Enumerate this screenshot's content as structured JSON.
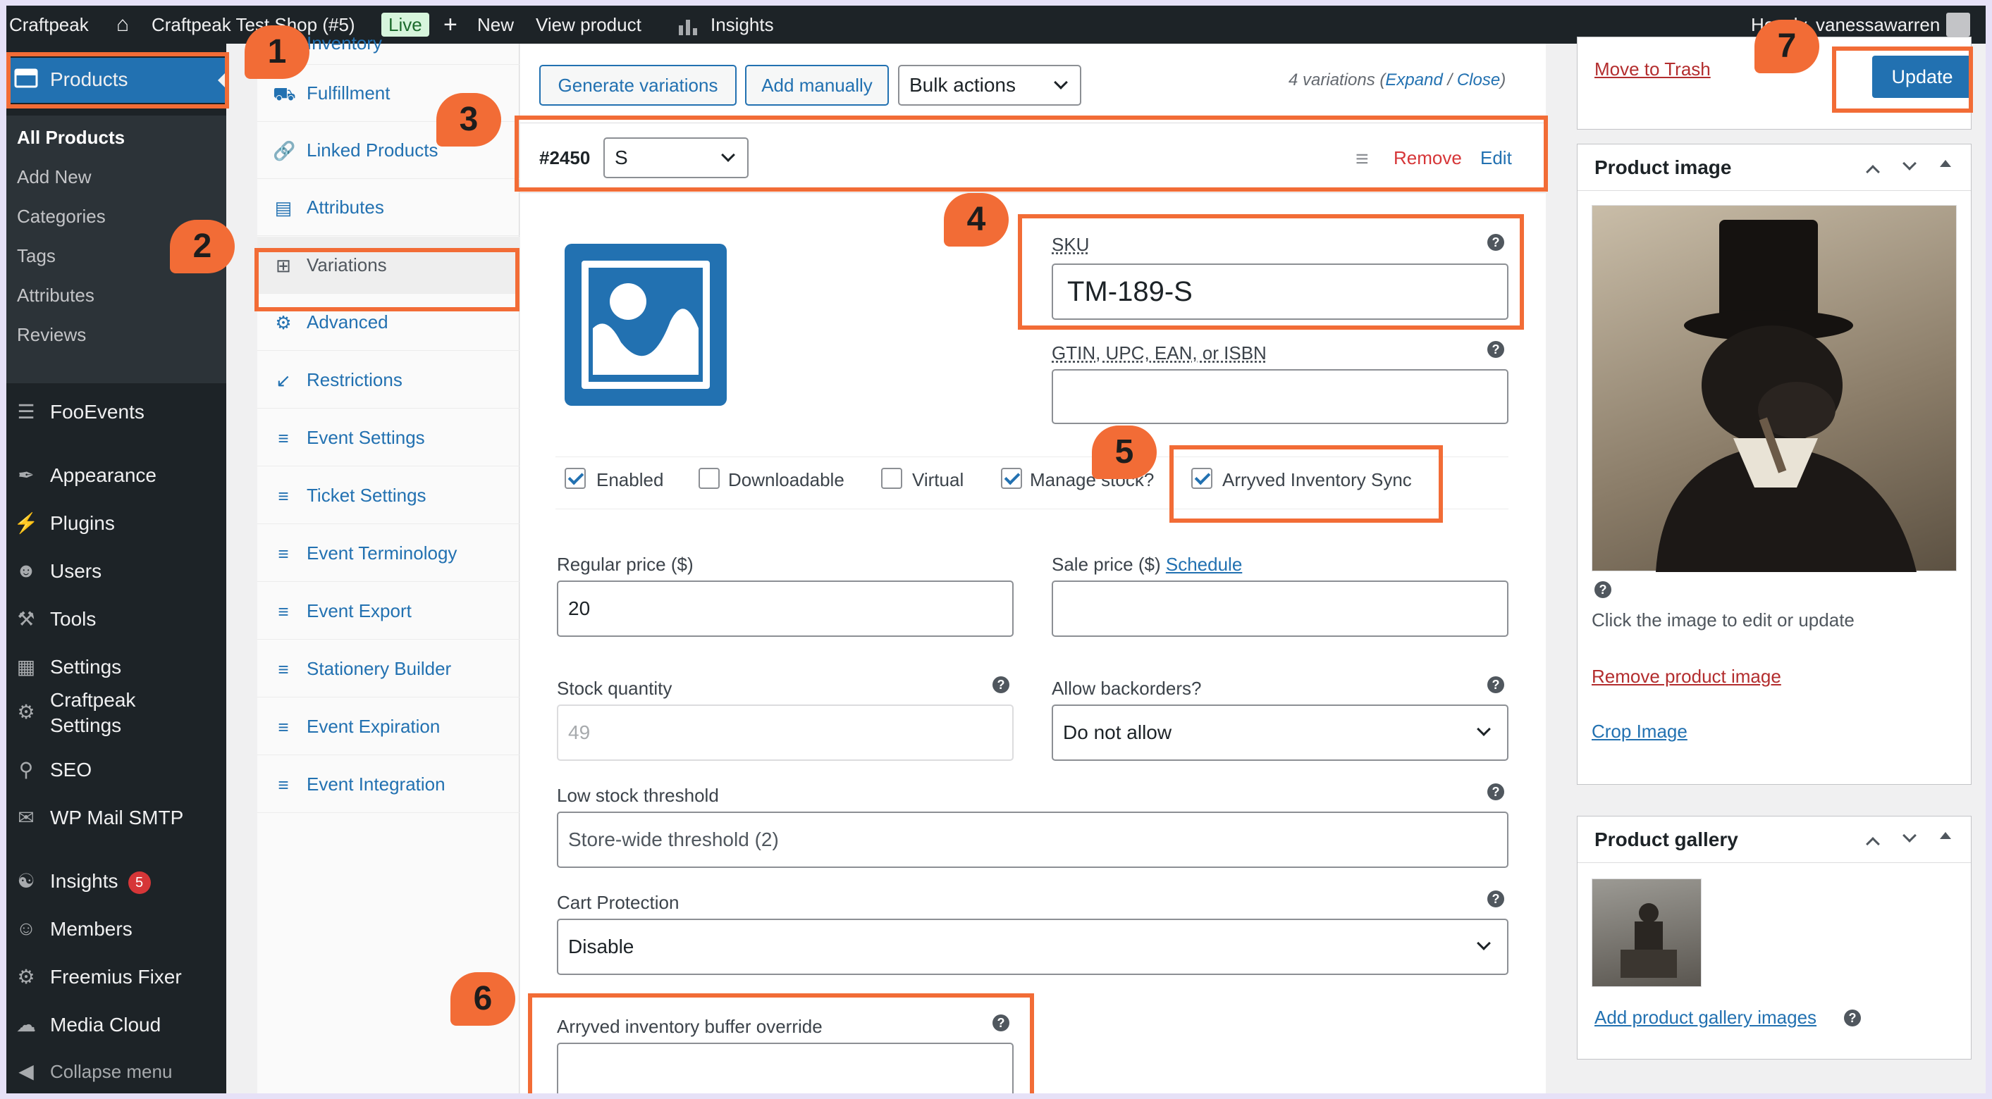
{
  "admin_bar": {
    "site_name": "Craftpeak",
    "shop_name": "Craftpeak Test Shop (#5)",
    "live_badge": "Live",
    "new_label": "New",
    "view_product": "View product",
    "insights": "Insights",
    "greeting": "Howdy, vanessawarren"
  },
  "sidebar": {
    "active_item": "Products",
    "submenu": [
      "All Products",
      "Add New",
      "Categories",
      "Tags",
      "Attributes",
      "Reviews"
    ],
    "items": [
      {
        "label": "FooEvents",
        "icon": "fooevents-icon"
      },
      {
        "label": "Appearance",
        "icon": "brush-icon"
      },
      {
        "label": "Plugins",
        "icon": "plugin-icon"
      },
      {
        "label": "Users",
        "icon": "user-icon"
      },
      {
        "label": "Tools",
        "icon": "wrench-icon"
      },
      {
        "label": "Settings",
        "icon": "settings-icon"
      },
      {
        "label": "Craftpeak Settings",
        "icon": "craftpeak-icon"
      },
      {
        "label": "SEO",
        "icon": "search-icon"
      },
      {
        "label": "WP Mail SMTP",
        "icon": "mail-icon"
      },
      {
        "label": "Insights",
        "icon": "insights-icon",
        "badge": "5"
      },
      {
        "label": "Members",
        "icon": "members-icon"
      },
      {
        "label": "Freemius Fixer",
        "icon": "gear-icon"
      },
      {
        "label": "Media Cloud",
        "icon": "cloud-icon"
      },
      {
        "label": "Collapse menu",
        "icon": "collapse-icon"
      }
    ]
  },
  "product_tabs": [
    {
      "label": "Inventory",
      "icon": "inventory-icon"
    },
    {
      "label": "Fulfillment",
      "icon": "truck-icon"
    },
    {
      "label": "Linked Products",
      "icon": "link-icon"
    },
    {
      "label": "Attributes",
      "icon": "list-icon"
    },
    {
      "label": "Variations",
      "icon": "grid-icon",
      "active": true
    },
    {
      "label": "Advanced",
      "icon": "gear-icon"
    },
    {
      "label": "Restrictions",
      "icon": "shrink-icon"
    },
    {
      "label": "Event Settings",
      "icon": "stack-icon"
    },
    {
      "label": "Ticket Settings",
      "icon": "stack-icon"
    },
    {
      "label": "Event Terminology",
      "icon": "stack-icon"
    },
    {
      "label": "Event Export",
      "icon": "stack-icon"
    },
    {
      "label": "Stationery Builder",
      "icon": "stack-icon"
    },
    {
      "label": "Event Expiration",
      "icon": "stack-icon"
    },
    {
      "label": "Event Integration",
      "icon": "stack-icon"
    }
  ],
  "toolbar": {
    "generate_variations": "Generate variations",
    "add_manually": "Add manually",
    "bulk_actions": "Bulk actions",
    "variations_count": "4 variations",
    "expand": "Expand",
    "slash": "/",
    "close": "Close"
  },
  "variation": {
    "id": "#2450",
    "attribute_value": "S",
    "remove": "Remove",
    "edit": "Edit",
    "sku_label": "SKU",
    "sku_value": "TM-189-S",
    "gtin_label": "GTIN, UPC, EAN, or ISBN",
    "gtin_value": "",
    "checkboxes": [
      {
        "label": "Enabled",
        "checked": true
      },
      {
        "label": "Downloadable",
        "checked": false
      },
      {
        "label": "Virtual",
        "checked": false
      },
      {
        "label": "Manage stock?",
        "checked": true
      },
      {
        "label": "Arryved Inventory Sync",
        "checked": true
      }
    ],
    "regular_price_label": "Regular price ($)",
    "regular_price_value": "20",
    "sale_price_label": "Sale price ($)",
    "schedule_link": "Schedule",
    "sale_price_value": "",
    "stock_qty_label": "Stock quantity",
    "stock_qty_placeholder": "49",
    "backorders_label": "Allow backorders?",
    "backorders_value": "Do not allow",
    "low_stock_label": "Low stock threshold",
    "low_stock_placeholder": "Store-wide threshold (2)",
    "cart_protection_label": "Cart Protection",
    "cart_protection_value": "Disable",
    "buffer_label": "Arryved inventory buffer override",
    "buffer_value": ""
  },
  "publish": {
    "move_to_trash": "Move to Trash",
    "update": "Update"
  },
  "product_image": {
    "title": "Product image",
    "hint": "Click the image to edit or update",
    "remove": "Remove product image",
    "crop": "Crop Image"
  },
  "product_gallery": {
    "title": "Product gallery",
    "add": "Add product gallery images"
  },
  "annotations": [
    "1",
    "2",
    "3",
    "4",
    "5",
    "6",
    "7"
  ],
  "colors": {
    "accent": "#2271b1",
    "annotation": "#f26c36",
    "danger": "#b32d2e",
    "admin_dark": "#1d2327"
  }
}
